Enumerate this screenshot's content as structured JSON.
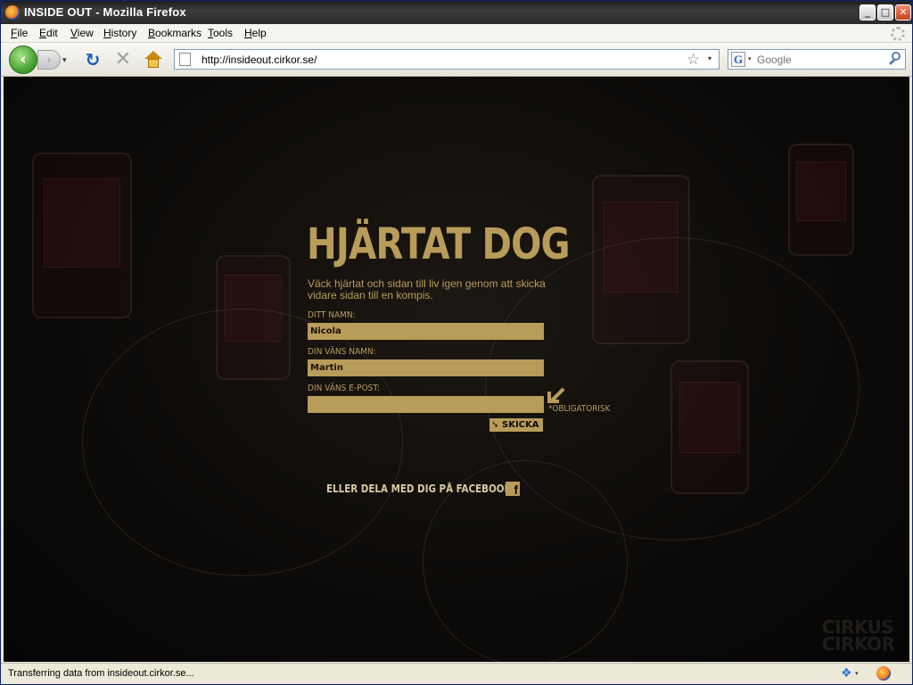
{
  "window": {
    "title": "INSIDE OUT - Mozilla Firefox",
    "controls": {
      "minimize": "_",
      "maximize": "□",
      "close": "✕"
    }
  },
  "menubar": {
    "items": [
      {
        "accel": "F",
        "rest": "ile"
      },
      {
        "accel": "E",
        "rest": "dit"
      },
      {
        "accel": "V",
        "rest": "iew"
      },
      {
        "accel": "H",
        "rest": "istory"
      },
      {
        "accel": "B",
        "rest": "ookmarks"
      },
      {
        "accel": "T",
        "rest": "ools"
      },
      {
        "accel": "H",
        "rest": "elp"
      }
    ]
  },
  "navbar": {
    "back_glyph": "‹",
    "forward_glyph": "›",
    "reload_glyph": "↻",
    "stop_glyph": "✕",
    "url": "http://insideout.cirkor.se/",
    "search_engine_glyph": "G",
    "search_placeholder": "Google",
    "star_glyph": "☆",
    "drop_glyph": "▾"
  },
  "page": {
    "heading": "HJÄRTAT DOG",
    "intro": "Väck hjärtat och sidan till liv igen genom att skicka vidare sidan till en kompis.",
    "form": {
      "your_name_label": "DITT NAMN:",
      "your_name_value": "Nicola",
      "friend_name_label": "DIN VÄNS NAMN:",
      "friend_name_value": "Martin",
      "friend_email_label": "DIN VÄNS E-POST:",
      "friend_email_value": "",
      "required_note": "*OBLIGATORISK",
      "submit_label": "SKICKA",
      "submit_glyph": "➘"
    },
    "facebook_text": "ELLER DELA MED DIG PÅ FACEBOOK",
    "facebook_glyph": "f",
    "brand_line1": "CIRKUS",
    "brand_line2": "CIRKOR"
  },
  "statusbar": {
    "text": "Transferring data from insideout.cirkor.se...",
    "addon_glyph": "❖"
  },
  "colors": {
    "accent_gold": "#b89c5a",
    "page_background": "#0d0b09"
  }
}
